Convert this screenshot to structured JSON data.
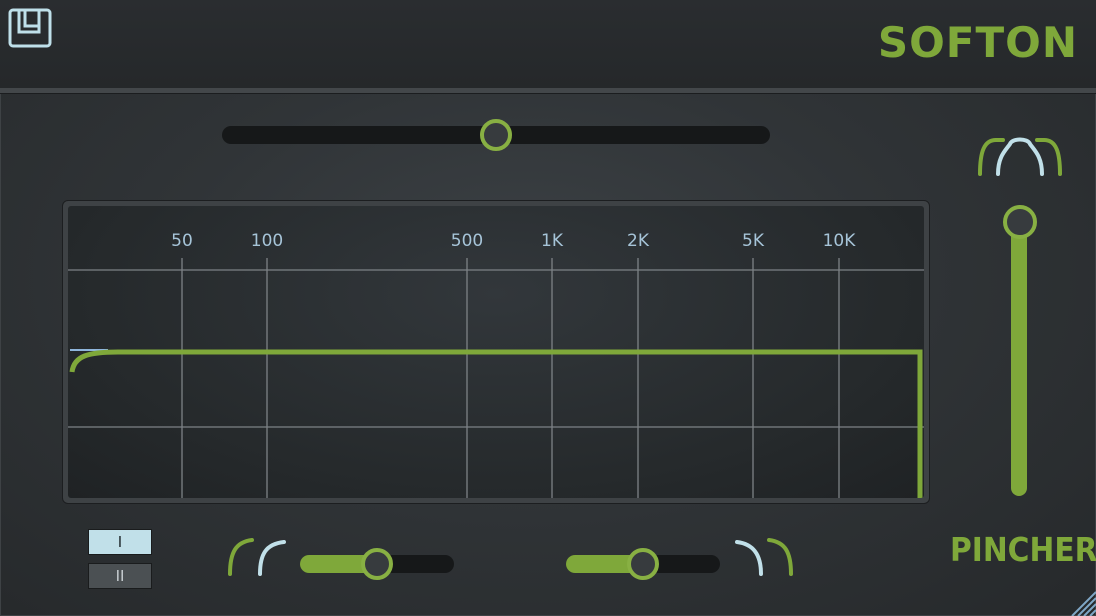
{
  "brand": {
    "name": "SOFTON"
  },
  "icons": {
    "logo": "logo-icon",
    "pincher": "pincher-shape-icon",
    "low_cut": "low-cut-shape-icon",
    "high_cut": "high-cut-shape-icon"
  },
  "colors": {
    "accent_green": "#7fa83a",
    "frequency_label": "#a6c4d8",
    "mode_active": "#c1e0e9",
    "mode_inactive": "#4b5053"
  },
  "top_slider": {
    "value": 0.5
  },
  "graph": {
    "frequency_labels": [
      "50",
      "100",
      "500",
      "1K",
      "2K",
      "5K",
      "10K"
    ]
  },
  "pincher": {
    "label": "PINCHER",
    "value": 1.0
  },
  "modes": [
    {
      "label": "I",
      "active": true
    },
    {
      "label": "II",
      "active": false
    }
  ],
  "low_cut_slider": {
    "value": 0.5
  },
  "high_cut_slider": {
    "value": 0.5
  }
}
